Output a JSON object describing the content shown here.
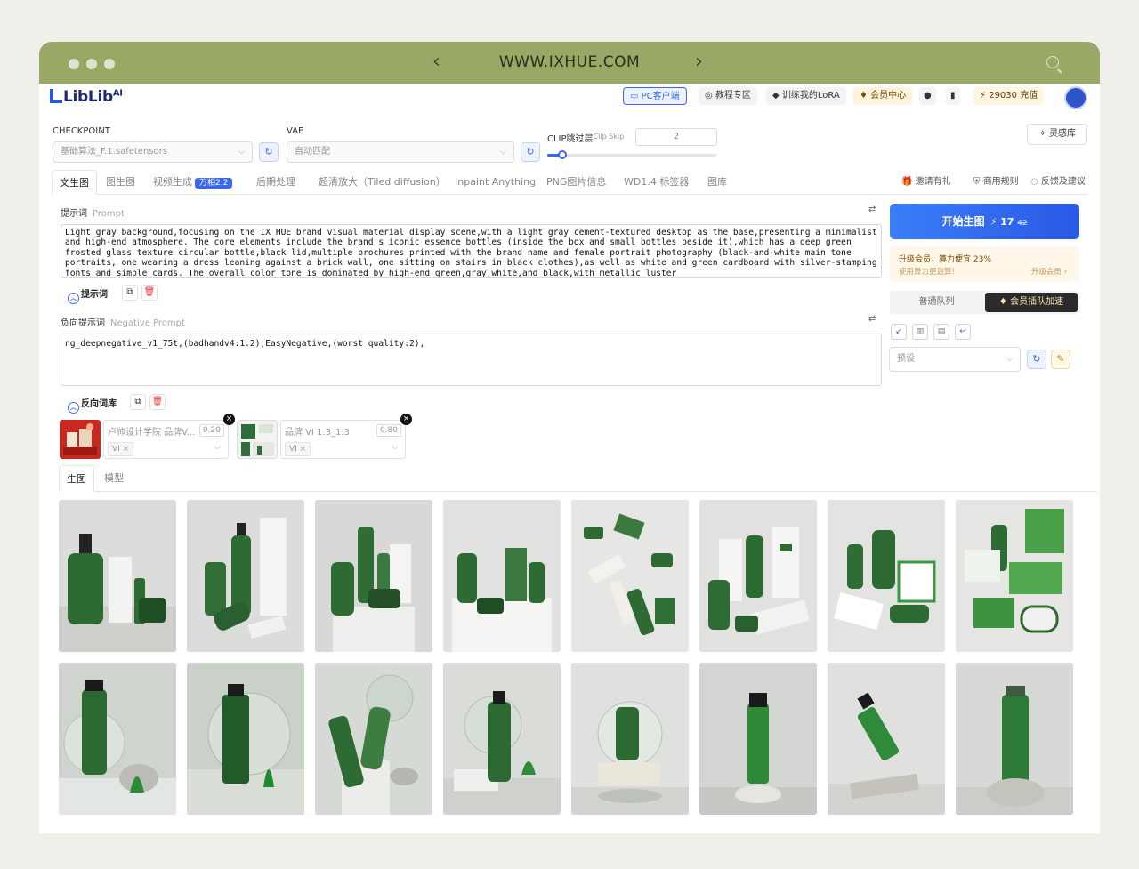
{
  "browser": {
    "url": "WWW.IXHUE.COM",
    "back_icon": "chevron-left-icon",
    "forward_icon": "chevron-right-icon",
    "search_icon": "search-icon"
  },
  "app": {
    "logo": "LibLib",
    "logo_sup": "AI",
    "toolbar": {
      "pc_client": "PC客户端",
      "tutorial": "教程专区",
      "train_lora": "训练我的LoRA",
      "member_center": "会员中心",
      "points": "29030 充值"
    }
  },
  "settings": {
    "checkpoint_label": "CHECKPOINT",
    "checkpoint_value": "基础算法_F.1.safetensors",
    "vae_label": "VAE",
    "vae_value": "自动匹配",
    "clip_label": "CLIP跳过层",
    "clip_label_en": "Clip Skip",
    "clip_value": "2",
    "inspiration": "灵感库"
  },
  "tabs": [
    {
      "label": "文生图"
    },
    {
      "label": "图生图"
    },
    {
      "label": "视频生成"
    },
    {
      "label": "后期处理"
    },
    {
      "label": "超清放大（Tiled diffusion）"
    },
    {
      "label": "Inpaint Anything"
    },
    {
      "label": "PNG图片信息"
    },
    {
      "label": "WD1.4 标签器"
    },
    {
      "label": "图库"
    }
  ],
  "video_badge": "万相2.2",
  "right_links": {
    "invite": "邀请有礼",
    "rules": "商用规则",
    "feedback": "反馈及建议"
  },
  "prompt": {
    "label": "提示词",
    "label_en": "Prompt",
    "text": "Light gray background,focusing on the IX HUE brand visual material display scene,with a light gray cement-textured desktop as the base,presenting a minimalist and high-end atmosphere. The core elements include the brand's iconic essence bottles (inside the box and small bottles beside it),which has a deep green frosted glass texture circular bottle,black lid,multiple brochures printed with the brand name and female portrait photography (black-and-white main tone portraits, one wearing a dress leaning against a brick wall, one sitting on stairs in black clothes),as well as white and green cardboard with silver-stamping fonts and simple cards. The overall color tone is dominated by high-end green,gray,white,and black,with metallic luster",
    "button": "提示词"
  },
  "negative": {
    "label": "负向提示词",
    "label_en": "Negative Prompt",
    "text": "ng_deepnegative_v1_75t,(badhandv4:1.2),EasyNegative,(worst quality:2),",
    "button": "反向词库"
  },
  "loras": [
    {
      "name": "卢帅设计学院 品牌V...",
      "weight": "0.20",
      "tag": "VI"
    },
    {
      "name": "品牌 VI 1.3_1.3",
      "weight": "0.80",
      "tag": "VI"
    }
  ],
  "subtabs": {
    "generate": "生图",
    "model": "模型"
  },
  "generate": {
    "button": "开始生图",
    "cost": "17",
    "orig_cost": "42",
    "upsell_title": "升级会员，算力便宜 23%",
    "upsell_sub": "使用算力更划算!",
    "upsell_link": "升级会员 ›",
    "queue_normal": "普通队列",
    "queue_vip": "会员插队加速",
    "preset_placeholder": "预设"
  },
  "colors": {
    "accent": "#3a67f1",
    "brand_green": "#2e6b2f",
    "chrome": "#98a865"
  }
}
